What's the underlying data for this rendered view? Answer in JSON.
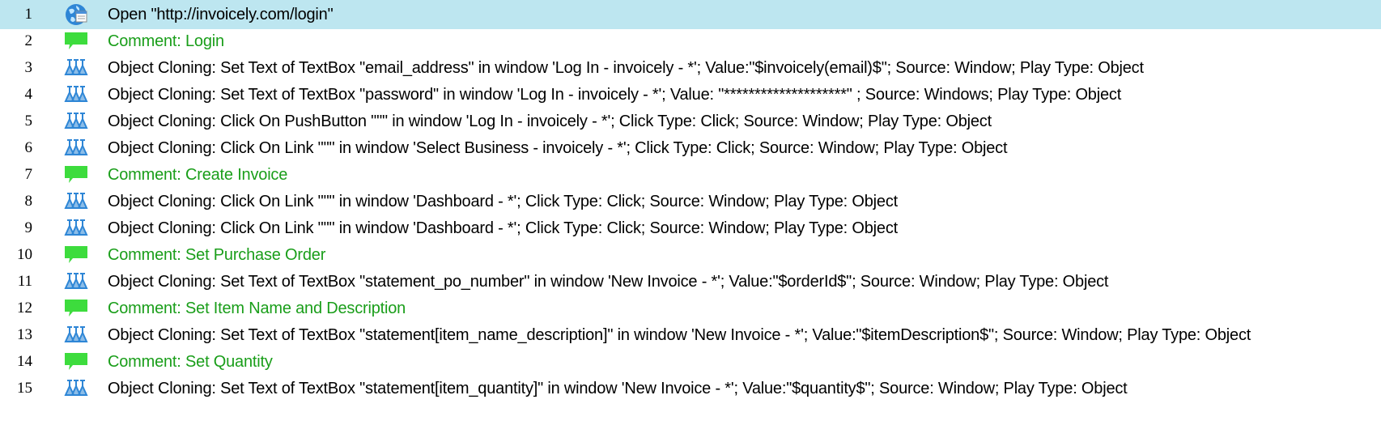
{
  "steps": [
    {
      "number": "1",
      "type": "open",
      "icon": "browser-open-icon",
      "text": "Open \"http://invoicely.com/login\""
    },
    {
      "number": "2",
      "type": "comment",
      "icon": "comment-icon",
      "text": "Comment: Login"
    },
    {
      "number": "3",
      "type": "action",
      "icon": "object-cloning-icon",
      "text": "Object Cloning: Set Text of TextBox \"email_address\" in window 'Log In - invoicely - *'; Value:\"$invoicely(email)$\"; Source: Window; Play Type: Object"
    },
    {
      "number": "4",
      "type": "action",
      "icon": "object-cloning-icon",
      "text": "Object Cloning: Set Text of TextBox \"password\" in window 'Log In - invoicely - *'; Value: \"********************\" ; Source: Windows; Play Type: Object"
    },
    {
      "number": "5",
      "type": "action",
      "icon": "object-cloning-icon",
      "text": "Object Cloning: Click On PushButton \"\"\" in window 'Log In - invoicely - *'; Click Type: Click; Source: Window; Play Type: Object"
    },
    {
      "number": "6",
      "type": "action",
      "icon": "object-cloning-icon",
      "text": "Object Cloning: Click On Link \"\"\" in window 'Select Business - invoicely - *'; Click Type: Click; Source: Window; Play Type: Object"
    },
    {
      "number": "7",
      "type": "comment",
      "icon": "comment-icon",
      "text": "Comment: Create Invoice"
    },
    {
      "number": "8",
      "type": "action",
      "icon": "object-cloning-icon",
      "text": "Object Cloning: Click On Link \"\"\" in window 'Dashboard - *'; Click Type: Click; Source: Window; Play Type: Object"
    },
    {
      "number": "9",
      "type": "action",
      "icon": "object-cloning-icon",
      "text": "Object Cloning: Click On Link \"\"\" in window 'Dashboard - *'; Click Type: Click; Source: Window; Play Type: Object"
    },
    {
      "number": "10",
      "type": "comment",
      "icon": "comment-icon",
      "text": "Comment: Set Purchase Order"
    },
    {
      "number": "11",
      "type": "action",
      "icon": "object-cloning-icon",
      "text": "Object Cloning: Set Text of TextBox \"statement_po_number\" in window 'New Invoice - *'; Value:\"$orderId$\"; Source: Window; Play Type: Object"
    },
    {
      "number": "12",
      "type": "comment",
      "icon": "comment-icon",
      "text": "Comment: Set Item Name and Description"
    },
    {
      "number": "13",
      "type": "action",
      "icon": "object-cloning-icon",
      "text": "Object Cloning: Set Text of TextBox \"statement[item_name_description]\" in window 'New Invoice - *'; Value:\"$itemDescription$\"; Source: Window; Play Type: Object"
    },
    {
      "number": "14",
      "type": "comment",
      "icon": "comment-icon",
      "text": "Comment: Set Quantity"
    },
    {
      "number": "15",
      "type": "action",
      "icon": "object-cloning-icon",
      "text": "Object Cloning: Set Text of TextBox \"statement[item_quantity]\" in window 'New Invoice - *'; Value:\"$quantity$\"; Source: Window; Play Type: Object"
    }
  ],
  "selected_step": "1",
  "colors": {
    "selected_row": "#bde6f0",
    "comment_text": "#1a9e1a",
    "comment_icon": "#3ddc3d",
    "cloning_icon": "#2e86d6"
  }
}
